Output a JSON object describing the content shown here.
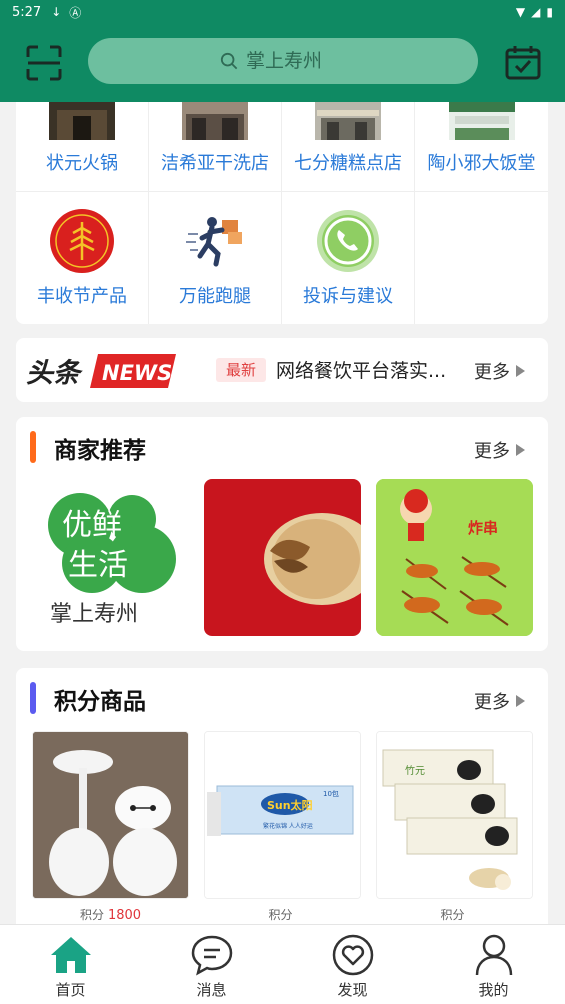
{
  "statusbar": {
    "time": "5:27"
  },
  "header": {
    "search_placeholder": "掌上寿州"
  },
  "services": [
    {
      "label": "状元火锅"
    },
    {
      "label": "洁希亚干洗店"
    },
    {
      "label": "七分糖糕点店"
    },
    {
      "label": "陶小邪大饭堂"
    },
    {
      "label": "丰收节产品"
    },
    {
      "label": "万能跑腿"
    },
    {
      "label": "投诉与建议"
    }
  ],
  "news": {
    "logo_cn": "头条",
    "logo_en": "NEWS",
    "badge": "最新",
    "headline": "网络餐饮平台落实...",
    "more": "更多"
  },
  "merchants": {
    "title": "商家推荐",
    "more": "更多",
    "accent": "#ff6a1a",
    "items": [
      {
        "image": "youxian-shenghuo-logo",
        "logo_text_1": "优鲜",
        "logo_text_2": "生活",
        "logo_caption": "掌上寿州"
      },
      {
        "image": "flatbread-photo"
      },
      {
        "image": "bbq-skewers-poster",
        "poster_text": "炸串"
      }
    ]
  },
  "products": {
    "title": "积分商品",
    "more": "更多",
    "accent": "#5b5bf0",
    "points_label": "积分",
    "items": [
      {
        "image": "baymax-lamp",
        "points": "1800"
      },
      {
        "image": "sun-tissue-pack",
        "brand": "Sun太阳",
        "pack": "10包",
        "slogan": "繁花似锦 人人好运"
      },
      {
        "image": "bamboo-tissue-rolls",
        "tag": "竹元"
      }
    ]
  },
  "bottom_nav": [
    {
      "label": "首页",
      "icon": "home-icon",
      "active": true
    },
    {
      "label": "消息",
      "icon": "message-icon",
      "active": false
    },
    {
      "label": "发现",
      "icon": "heart-discover-icon",
      "active": false
    },
    {
      "label": "我的",
      "icon": "user-icon",
      "active": false
    }
  ],
  "colors": {
    "primary": "#0f8a63",
    "link": "#2a7ad8",
    "points": "#e0353b"
  }
}
